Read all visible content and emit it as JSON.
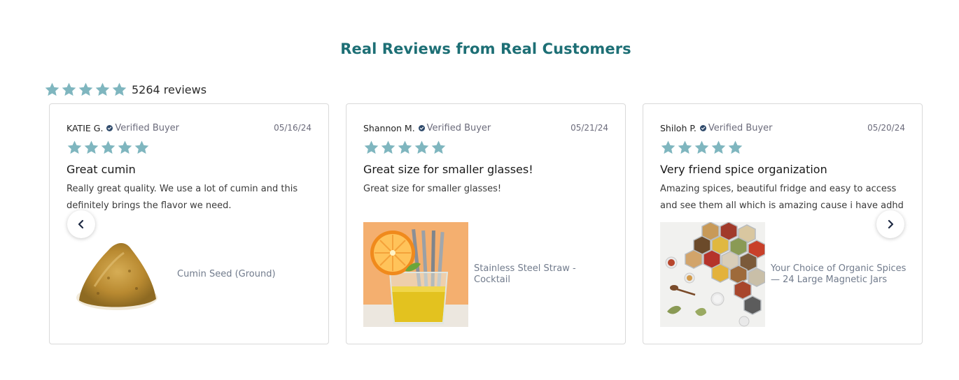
{
  "section": {
    "title": "Real Reviews from Real Customers"
  },
  "summary": {
    "rating": 5,
    "count_text": "5264 reviews"
  },
  "colors": {
    "star": "#7fb6bf",
    "title": "#1d6f75",
    "verified": "#2f4a6b"
  },
  "reviews": [
    {
      "name": "KATIE G.",
      "verified_label": "Verified Buyer",
      "date": "05/16/24",
      "rating": 5,
      "title": "Great cumin",
      "body": "Really great quality. We use a lot of cumin and this definitely brings the flavor we need.",
      "product": {
        "name": "Cumin Seed (Ground)",
        "image": "cumin-powder"
      }
    },
    {
      "name": "Shannon M.",
      "verified_label": "Verified Buyer",
      "date": "05/21/24",
      "rating": 5,
      "title": "Great size for smaller glasses!",
      "body": "Great size for smaller glasses!",
      "product": {
        "name": "Stainless Steel Straw - Cocktail",
        "image": "cocktail-straws"
      }
    },
    {
      "name": "Shiloh P.",
      "verified_label": "Verified Buyer",
      "date": "05/20/24",
      "rating": 5,
      "title": "Very friend spice organization",
      "body": "Amazing spices, beautiful fridge and easy to access and see them all which is amazing cause i have adhd",
      "product": {
        "name": "Your Choice of Organic Spices — 24 Large Magnetic Jars",
        "image": "magnetic-spice-jars"
      }
    }
  ],
  "nav": {
    "prev_icon": "chevron-left-icon",
    "next_icon": "chevron-right-icon"
  }
}
